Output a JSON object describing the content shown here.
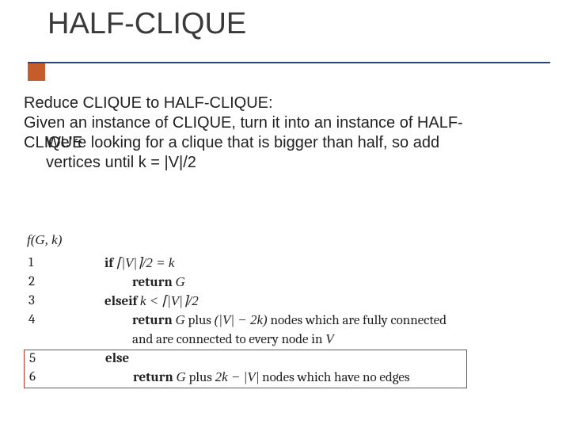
{
  "title": "HALF-CLIQUE",
  "body": {
    "line1": "Reduce CLIQUE to HALF-CLIQUE:",
    "line2": "Given an instance of CLIQUE, turn it into an instance of HALF-",
    "line3a": "CLIQUE",
    "line3b_overlay": "We're looking for a clique that is bigger than half, so add",
    "line4": "vertices until k = |V|/2"
  },
  "algo": {
    "head": "f(G, k)",
    "rows": [
      {
        "n": "1",
        "text": "if ⌈|V|⌉/2 = k",
        "kind": "if"
      },
      {
        "n": "2",
        "text": "return G",
        "kind": "ret"
      },
      {
        "n": "3",
        "text": "elseif k < ⌈|V|⌉/2",
        "kind": "elseif"
      },
      {
        "n": "4",
        "text": "return G plus (|V| − 2k) nodes which are fully connected",
        "kind": "ret"
      },
      {
        "n": "",
        "text": "and are connected to every node in V",
        "kind": "cont"
      },
      {
        "n": "5",
        "text": "else",
        "kind": "else"
      },
      {
        "n": "6",
        "text": "return G plus 2k − |V| nodes which have no edges",
        "kind": "ret"
      }
    ]
  }
}
